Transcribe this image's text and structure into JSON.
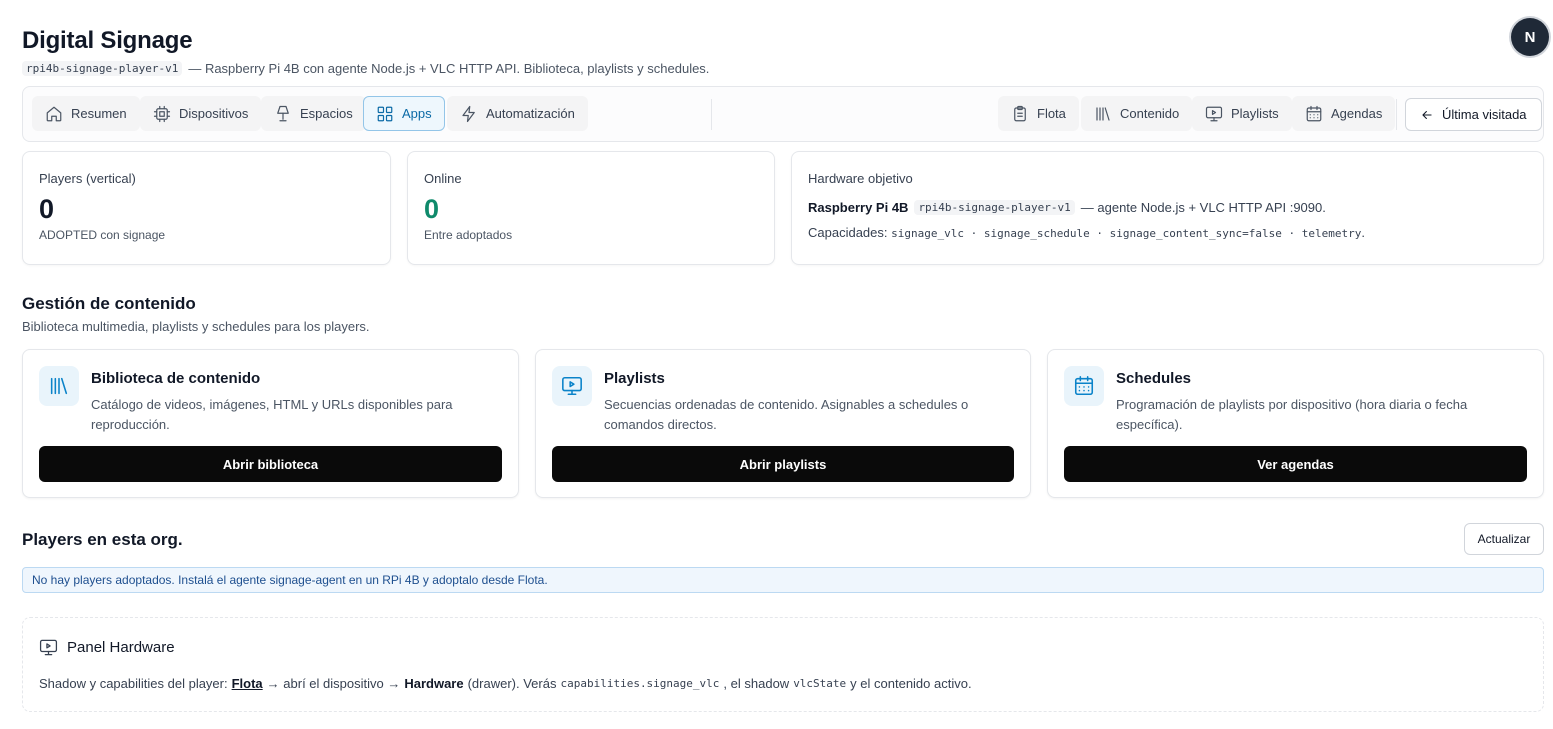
{
  "header": {
    "title": "Digital Signage",
    "code": "rpi4b-signage-player-v1",
    "subtitle": "— Raspberry Pi 4B con agente Node.js + VLC HTTP API. Biblioteca, playlists y schedules."
  },
  "avatar": {
    "initial": "N"
  },
  "nav": {
    "left": [
      {
        "label": "Resumen",
        "icon": "home-icon"
      },
      {
        "label": "Dispositivos",
        "icon": "cpu-icon"
      },
      {
        "label": "Espacios",
        "icon": "lamp-icon"
      },
      {
        "label": "Apps",
        "icon": "grid-icon",
        "active": true
      },
      {
        "label": "Automatización",
        "icon": "bolt-icon"
      }
    ],
    "right": [
      {
        "label": "Flota",
        "icon": "clipboard-icon"
      },
      {
        "label": "Contenido",
        "icon": "library-icon"
      },
      {
        "label": "Playlists",
        "icon": "monitor-play-icon"
      },
      {
        "label": "Agendas",
        "icon": "calendar-icon"
      }
    ],
    "back_label": "Última visitada"
  },
  "stats": {
    "players": {
      "label": "Players (vertical)",
      "value": "0",
      "sub": "ADOPTED con signage"
    },
    "online": {
      "label": "Online",
      "value": "0",
      "sub": "Entre adoptados"
    },
    "hardware": {
      "label": "Hardware objetivo",
      "device": "Raspberry Pi 4B",
      "code": "rpi4b-signage-player-v1",
      "agent": "— agente Node.js + VLC HTTP API :9090.",
      "cap_label": "Capacidades:",
      "caps": "signage_vlc · signage_schedule · signage_content_sync=false · telemetry",
      "cap_end": "."
    }
  },
  "content_section": {
    "title": "Gestión de contenido",
    "subtitle": "Biblioteca multimedia, playlists y schedules para los players."
  },
  "cards": [
    {
      "title": "Biblioteca de contenido",
      "desc": "Catálogo de videos, imágenes, HTML y URLs disponibles para reproducción.",
      "button": "Abrir biblioteca",
      "icon": "library-icon"
    },
    {
      "title": "Playlists",
      "desc": "Secuencias ordenadas de contenido. Asignables a schedules o comandos directos.",
      "button": "Abrir playlists",
      "icon": "monitor-play-icon"
    },
    {
      "title": "Schedules",
      "desc": "Programación de playlists por dispositivo (hora diaria o fecha específica).",
      "button": "Ver agendas",
      "icon": "calendar-icon"
    }
  ],
  "players_section": {
    "title": "Players en esta org.",
    "refresh": "Actualizar",
    "alert": "No hay players adoptados. Instalá el agente signage-agent en un RPi 4B y adoptalo desde Flota."
  },
  "panel": {
    "title": "Panel Hardware",
    "t1": "Shadow y capabilities del player:",
    "link": "Flota",
    "t2": "→ abrí el dispositivo →",
    "bold": "Hardware",
    "t3": "(drawer). Verás",
    "code1": "capabilities.signage_vlc",
    "t4": ", el shadow",
    "code2": "vlcState",
    "t5": "y el contenido activo."
  },
  "colors": {
    "accent": "#0b83c9",
    "online": "#0f8a6b",
    "button": "#0a0a0a"
  }
}
